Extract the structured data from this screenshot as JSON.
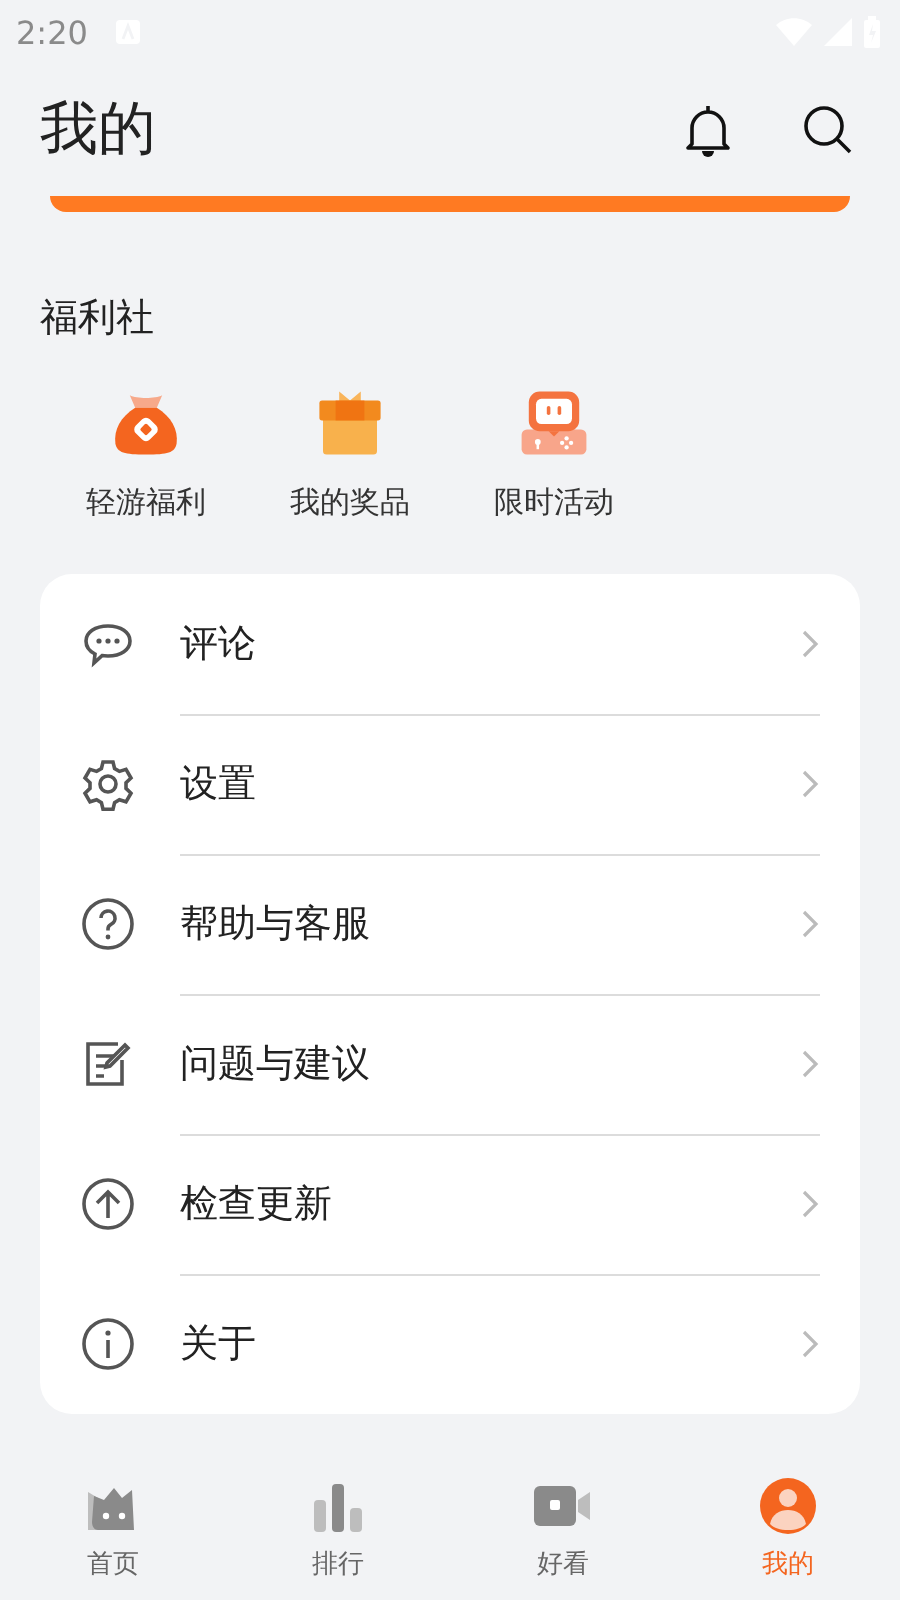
{
  "status_bar": {
    "time": "2:20"
  },
  "header": {
    "title": "我的"
  },
  "welfare": {
    "title": "福利社",
    "items": [
      {
        "kind": "bag",
        "label": "轻游福利"
      },
      {
        "kind": "gift",
        "label": "我的奖品"
      },
      {
        "kind": "game",
        "label": "限时活动"
      }
    ]
  },
  "menu": [
    {
      "kind": "comment",
      "label": "评论"
    },
    {
      "kind": "settings",
      "label": "设置"
    },
    {
      "kind": "help",
      "label": "帮助与客服"
    },
    {
      "kind": "feedback",
      "label": "问题与建议"
    },
    {
      "kind": "update",
      "label": "检查更新"
    },
    {
      "kind": "about",
      "label": "关于"
    }
  ],
  "bottom_nav": [
    {
      "kind": "home",
      "label": "首页",
      "selected": false
    },
    {
      "kind": "rank",
      "label": "排行",
      "selected": false
    },
    {
      "kind": "video",
      "label": "好看",
      "selected": false
    },
    {
      "kind": "profile",
      "label": "我的",
      "selected": true
    }
  ]
}
